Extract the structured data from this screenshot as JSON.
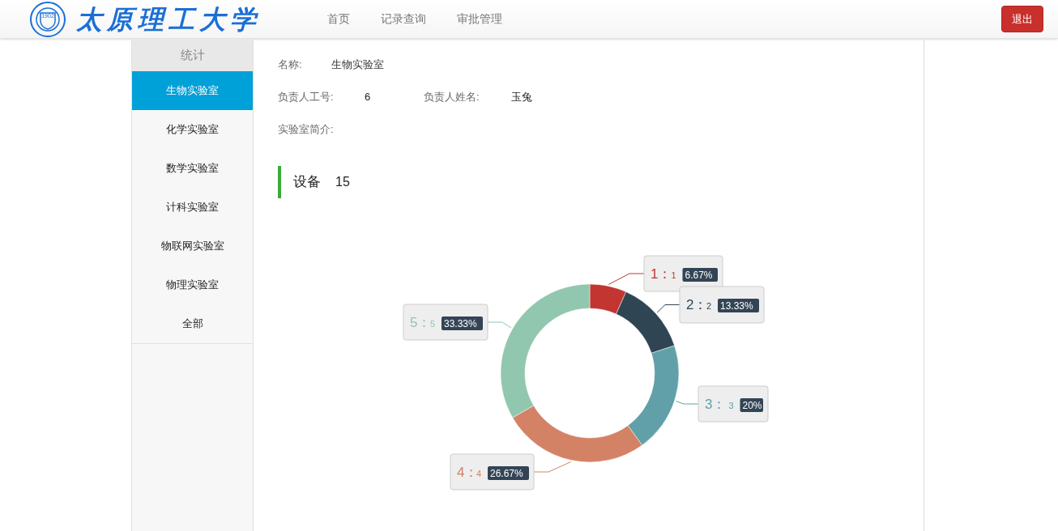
{
  "header": {
    "logo_text": "太原理工大学",
    "emblem_text": "1902",
    "nav": [
      {
        "label": "首页",
        "selected": false
      },
      {
        "label": "记录查询",
        "selected": false
      },
      {
        "label": "审批管理",
        "selected": false
      }
    ],
    "logout": "退出"
  },
  "sidebar": {
    "title": "统计",
    "items": [
      {
        "label": "生物实验室",
        "selected": true
      },
      {
        "label": "化学实验室",
        "selected": false
      },
      {
        "label": "数学实验室",
        "selected": false
      },
      {
        "label": "计科实验室",
        "selected": false
      },
      {
        "label": "物联网实验室",
        "selected": false
      },
      {
        "label": "物理实验室",
        "selected": false
      },
      {
        "label": "全部",
        "selected": false
      }
    ]
  },
  "lab": {
    "name_label": "名称:",
    "name": "生物实验室",
    "id_label": "负责人工号:",
    "id": "6",
    "person_label": "负责人姓名:",
    "person": "玉兔",
    "intro_label": "实验室简介:"
  },
  "equipment": {
    "title": "设备",
    "count": "15",
    "chart_data": {
      "type": "donut",
      "values": [
        6.67,
        13.33,
        20,
        26.67,
        33.33
      ]
    },
    "slice_labels": [
      {
        "name": "1：",
        "value": "1",
        "percent": "6.67%",
        "color": "#c23531"
      },
      {
        "name": "2：",
        "value": "2",
        "percent": "13.33%",
        "color": "#2f4554"
      },
      {
        "name": "3：",
        "value": "3",
        "percent": "20%",
        "color": "#61a0a8"
      },
      {
        "name": "4：",
        "value": "4",
        "percent": "26.67%",
        "color": "#d48265"
      },
      {
        "name": "5：",
        "value": "5",
        "percent": "33.33%",
        "color": "#91c7ae"
      }
    ]
  }
}
